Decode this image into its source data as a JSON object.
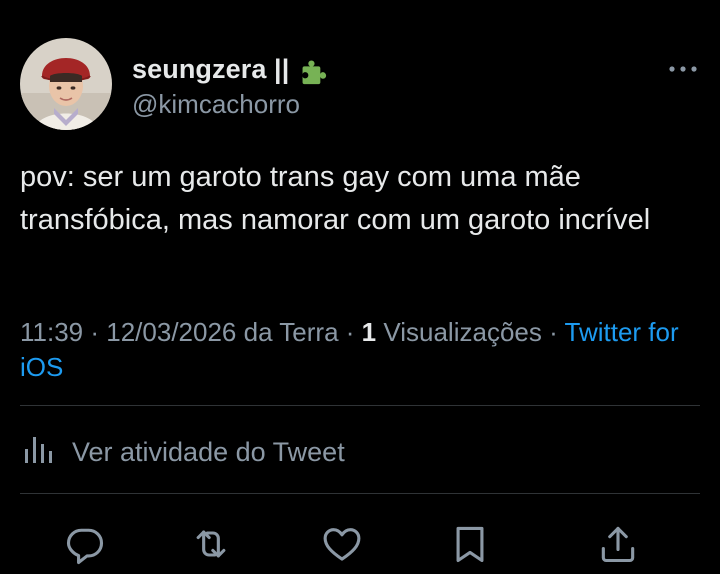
{
  "user": {
    "display_name": "seungzera ||",
    "handle": "@kimcachorro",
    "badge_icon": "puzzle-piece-icon",
    "avatar_icon": "profile-photo"
  },
  "tweet": {
    "text": "pov: ser um garoto trans gay com uma mãe transfóbica, mas namorar com um garoto incrível"
  },
  "meta": {
    "time": "11:39",
    "date": "12/03/2026",
    "location": "da Terra",
    "views_count": "1",
    "views_label": "Visualizações",
    "source": "Twitter for iOS",
    "separator": " · "
  },
  "activity": {
    "label": "Ver atividade do Tweet",
    "icon": "analytics-bars-icon"
  },
  "actions": [
    {
      "name": "reply",
      "icon": "reply-icon"
    },
    {
      "name": "retweet",
      "icon": "retweet-icon"
    },
    {
      "name": "like",
      "icon": "heart-icon"
    },
    {
      "name": "bookmark",
      "icon": "bookmark-icon"
    },
    {
      "name": "share",
      "icon": "share-icon"
    }
  ],
  "colors": {
    "background": "#000000",
    "text_primary": "#e7e9ea",
    "text_secondary": "#8b98a5",
    "accent": "#1d9bf0",
    "divider": "#2f3336",
    "badge_green": "#77b255"
  }
}
